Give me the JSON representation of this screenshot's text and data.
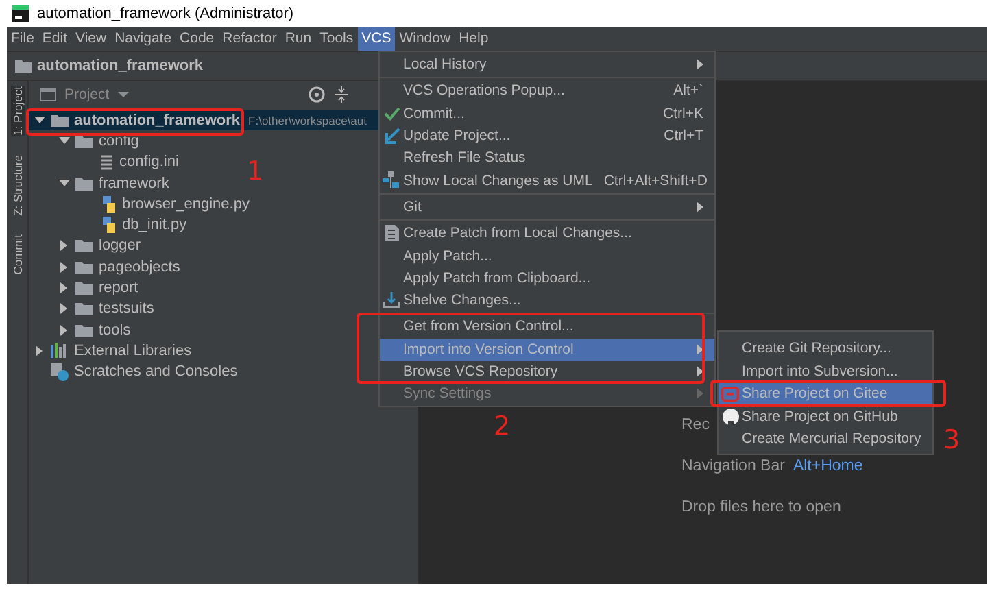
{
  "window": {
    "title": "automation_framework (Administrator)"
  },
  "menu_bar": [
    {
      "label": "File",
      "selected": false
    },
    {
      "label": "Edit",
      "selected": false
    },
    {
      "label": "View",
      "selected": false
    },
    {
      "label": "Navigate",
      "selected": false
    },
    {
      "label": "Code",
      "selected": false
    },
    {
      "label": "Refactor",
      "selected": false
    },
    {
      "label": "Run",
      "selected": false
    },
    {
      "label": "Tools",
      "selected": false
    },
    {
      "label": "VCS",
      "selected": true
    },
    {
      "label": "Window",
      "selected": false
    },
    {
      "label": "Help",
      "selected": false
    }
  ],
  "breadcrumb": "automation_framework",
  "tool_strip": [
    {
      "label": "1: Project",
      "selected": true
    },
    {
      "label": "Z: Structure",
      "selected": false
    },
    {
      "label": "Commit",
      "selected": false
    }
  ],
  "project_panel": {
    "title": "Project",
    "tree": [
      {
        "label": "automation_framework",
        "path": "F:\\other\\workspace\\aut",
        "kind": "folder",
        "expanded": true,
        "children": [
          {
            "label": "config",
            "kind": "folder",
            "expanded": true,
            "children": [
              {
                "label": "config.ini",
                "kind": "ini"
              }
            ]
          },
          {
            "label": "framework",
            "kind": "folder",
            "expanded": true,
            "children": [
              {
                "label": "browser_engine.py",
                "kind": "python"
              },
              {
                "label": "db_init.py",
                "kind": "python"
              }
            ]
          },
          {
            "label": "logger",
            "kind": "folder",
            "expanded": false
          },
          {
            "label": "pageobjects",
            "kind": "folder",
            "expanded": false
          },
          {
            "label": "report",
            "kind": "folder",
            "expanded": false
          },
          {
            "label": "testsuits",
            "kind": "folder",
            "expanded": false
          },
          {
            "label": "tools",
            "kind": "folder",
            "expanded": false
          }
        ]
      },
      {
        "label": "External Libraries",
        "kind": "library",
        "expanded": false
      },
      {
        "label": "Scratches and Consoles",
        "kind": "scratches"
      }
    ]
  },
  "vcs_menu": [
    [
      {
        "label": "Local History",
        "submenu": true,
        "selected": false,
        "disabled": false
      }
    ],
    [
      {
        "label": "VCS Operations Popup...",
        "shortcut": "Alt+`",
        "selected": false,
        "disabled": false
      },
      {
        "label": "Commit...",
        "shortcut": "Ctrl+K",
        "kind": "check",
        "selected": false,
        "disabled": false
      },
      {
        "label": "Update Project...",
        "shortcut": "Ctrl+T",
        "kind": "update",
        "selected": false,
        "disabled": false
      },
      {
        "label": "Refresh File Status",
        "selected": false,
        "disabled": false
      },
      {
        "label": "Show Local Changes as UML",
        "shortcut": "Ctrl+Alt+Shift+D",
        "kind": "uml",
        "selected": false,
        "disabled": false
      }
    ],
    [
      {
        "label": "Git",
        "submenu": true,
        "selected": false,
        "disabled": false
      }
    ],
    [
      {
        "label": "Create Patch from Local Changes...",
        "kind": "patch",
        "selected": false,
        "disabled": false
      },
      {
        "label": "Apply Patch...",
        "selected": false,
        "disabled": false
      },
      {
        "label": "Apply Patch from Clipboard...",
        "selected": false,
        "disabled": false
      },
      {
        "label": "Shelve Changes...",
        "kind": "shelve",
        "selected": false,
        "disabled": false
      }
    ],
    [
      {
        "label": "Get from Version Control...",
        "selected": false,
        "disabled": false
      },
      {
        "label": "Import into Version Control",
        "submenu": true,
        "selected": true,
        "disabled": false
      },
      {
        "label": "Browse VCS Repository",
        "submenu": true,
        "selected": false,
        "disabled": false
      },
      {
        "label": "Sync Settings",
        "submenu": true,
        "selected": false,
        "disabled": true
      }
    ]
  ],
  "import_submenu": [
    {
      "label": "Create Git Repository...",
      "selected": false
    },
    {
      "label": "Import into Subversion...",
      "selected": false
    },
    {
      "label": "Share Project on Gitee",
      "kind": "gitee",
      "selected": true
    },
    {
      "label": "Share Project on GitHub",
      "kind": "github",
      "selected": false
    },
    {
      "label": "Create Mercurial Repository",
      "selected": false
    }
  ],
  "editor": {
    "hints": [
      {
        "label": "Rec"
      },
      {
        "label": "Navigation Bar",
        "shortcut": "Alt+Home"
      },
      {
        "label": "Drop files here to open"
      }
    ]
  },
  "annotations": [
    "1",
    "2",
    "3"
  ]
}
